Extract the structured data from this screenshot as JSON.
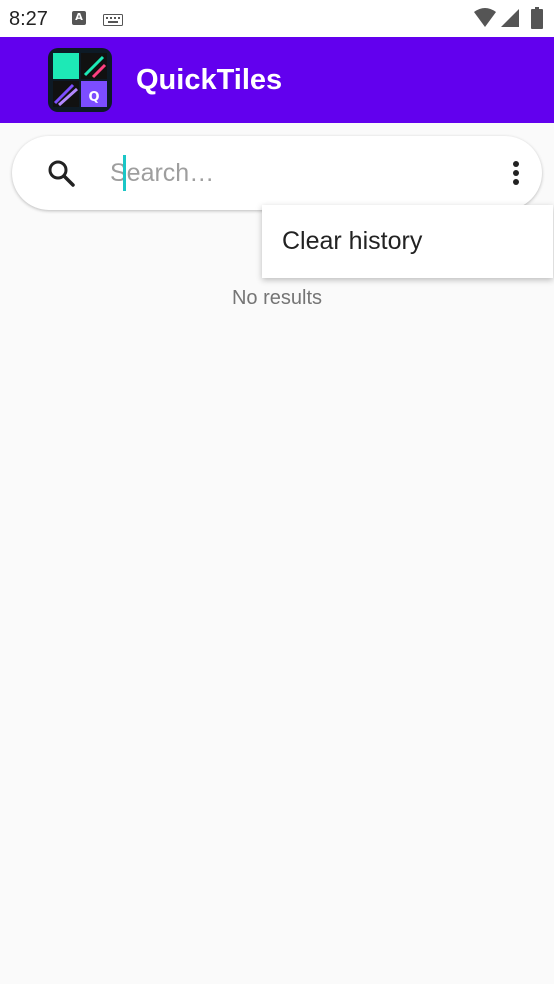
{
  "status_bar": {
    "time": "8:27"
  },
  "app_bar": {
    "title": "QuickTiles",
    "logo_letter": "Q"
  },
  "search": {
    "placeholder": "Search…",
    "value": ""
  },
  "popup_menu": {
    "items": [
      {
        "label": "Clear history"
      }
    ]
  },
  "results": {
    "empty_message": "No results"
  },
  "colors": {
    "app_bar": "#6200ee",
    "caret": "#1bc6c6",
    "background": "#fafafa"
  },
  "icons": {
    "search": "search-icon",
    "overflow": "more-vert-icon",
    "wifi": "wifi-icon",
    "signal": "cell-signal-icon",
    "battery": "battery-icon",
    "keyboard": "keyboard-icon",
    "notification": "a-notification-icon"
  }
}
